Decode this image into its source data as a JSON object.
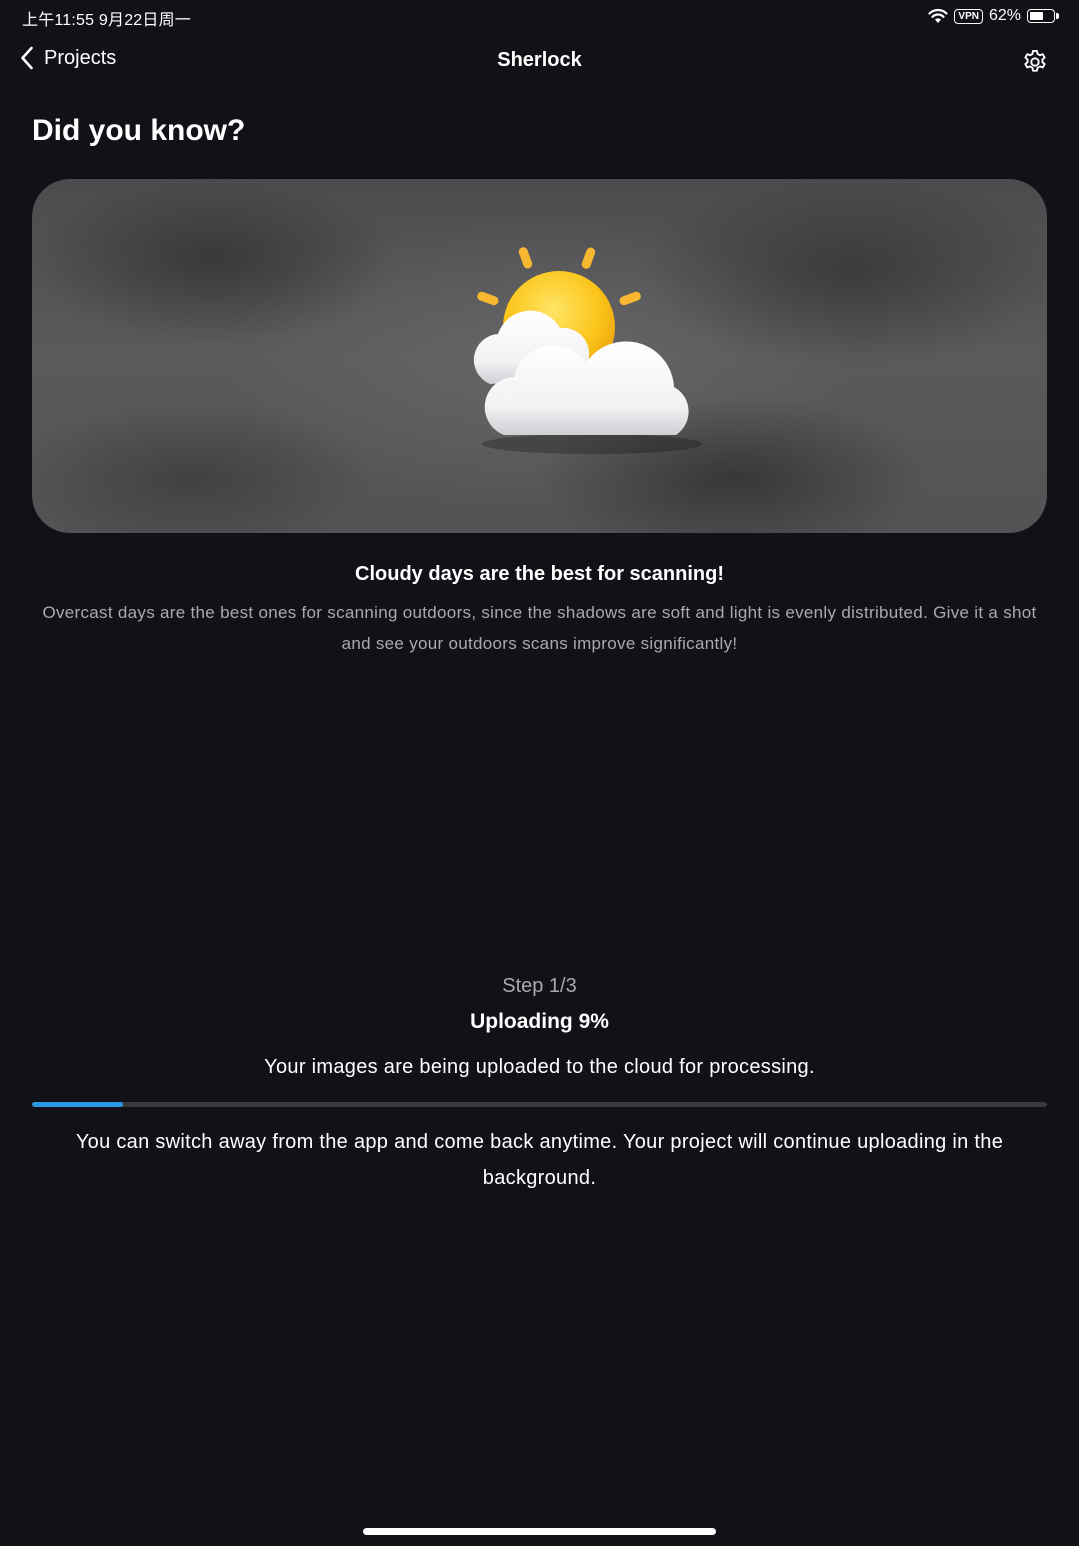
{
  "status_bar": {
    "time_date": "上午11:55   9月22日周一",
    "vpn": "VPN",
    "battery": "62%",
    "battery_level": 0.62
  },
  "nav": {
    "back_label": "Projects",
    "title": "Sherlock",
    "back_icon": "chevron-left-icon",
    "settings_icon": "gear-icon"
  },
  "heading": "Did you know?",
  "tip": {
    "illustration": "sun-behind-cloud",
    "title": "Cloudy days are the best for scanning!",
    "body": "Overcast days are the best ones for scanning outdoors, since the shadows are soft and light is evenly distributed. Give it a shot and see your outdoors scans improve significantly!"
  },
  "upload": {
    "step": "Step 1/3",
    "status": "Uploading 9%",
    "progress_percent": 9,
    "description": "Your images are being uploaded to the cloud for processing.",
    "background_note": "You can switch away from the app and come back anytime. Your project will continue uploading in the background."
  },
  "colors": {
    "background": "#111118",
    "accent": "#2a9ae6",
    "secondary_text": "#a9a9b0"
  }
}
